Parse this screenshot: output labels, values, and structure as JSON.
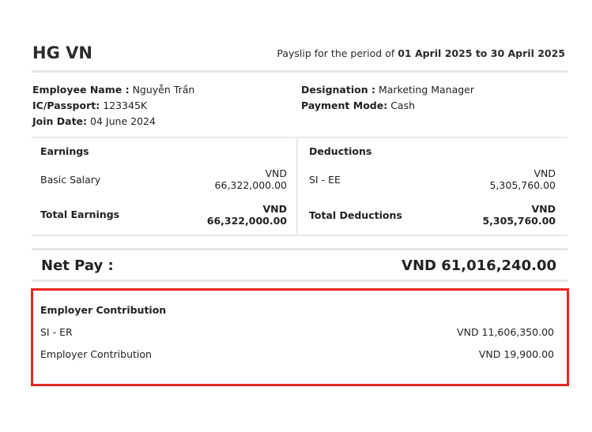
{
  "header": {
    "company": "HG VN",
    "period_prefix": "Payslip for the period of ",
    "period_range": "01 April 2025 to 30 April 2025"
  },
  "employee": {
    "name_label": "Employee Name :",
    "name": "Nguyễn Trần",
    "id_label": "IC/Passport:",
    "id": "123345K",
    "join_label": "Join Date:",
    "join_date": "04 June 2024",
    "designation_label": "Designation :",
    "designation": "Marketing Manager",
    "payment_label": "Payment Mode:",
    "payment_mode": "Cash"
  },
  "earnings": {
    "heading": "Earnings",
    "items": [
      {
        "label": "Basic Salary",
        "currency": "VND",
        "amount": "66,322,000.00"
      }
    ],
    "total_label": "Total Earnings",
    "total_currency": "VND",
    "total_amount": "66,322,000.00"
  },
  "deductions": {
    "heading": "Deductions",
    "items": [
      {
        "label": "SI - EE",
        "currency": "VND",
        "amount": "5,305,760.00"
      }
    ],
    "total_label": "Total Deductions",
    "total_currency": "VND",
    "total_amount": "5,305,760.00"
  },
  "net_pay": {
    "label": "Net Pay :",
    "amount": "VND 61,016,240.00"
  },
  "employer_contribution": {
    "heading": "Employer Contribution",
    "items": [
      {
        "label": "SI - ER",
        "amount": "VND 11,606,350.00"
      },
      {
        "label": "Employer Contribution",
        "amount": "VND 19,900.00"
      }
    ]
  },
  "colors": {
    "highlight_border": "#e8271f",
    "divider": "#e6e6e6"
  }
}
